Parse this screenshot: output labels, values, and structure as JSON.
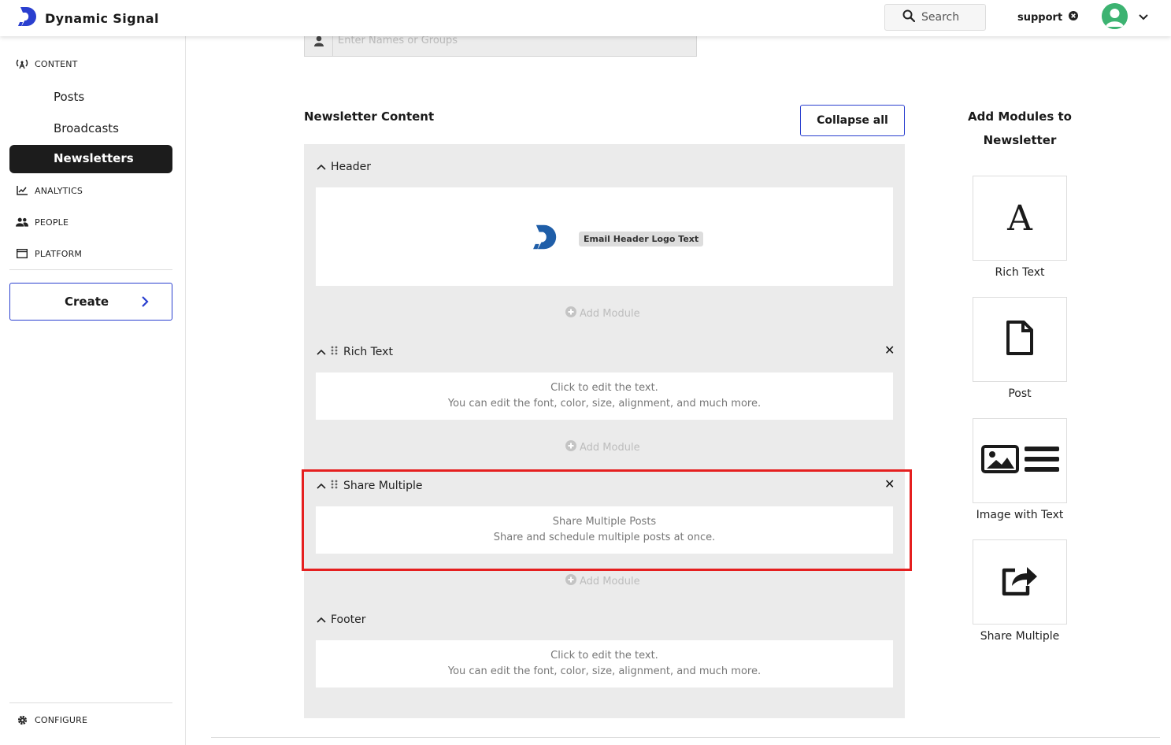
{
  "app": {
    "brand_name": "Dynamic Signal",
    "brand_color": "#2a3fcf",
    "accent_color": "#2a3fcf",
    "highlight_color": "#e51f1f"
  },
  "topbar": {
    "search_label": "Search",
    "user_label": "support"
  },
  "sidebar": {
    "content_label": "CONTENT",
    "content_items": [
      {
        "label": "Posts"
      },
      {
        "label": "Broadcasts"
      },
      {
        "label": "Newsletters",
        "active": true
      }
    ],
    "analytics_label": "ANALYTICS",
    "people_label": "PEOPLE",
    "platform_label": "PLATFORM",
    "create_label": "Create",
    "configure_label": "CONFIGURE"
  },
  "recipients": {
    "placeholder": "Enter Names or Groups"
  },
  "newsletter": {
    "section_title": "Newsletter Content",
    "collapse_all_label": "Collapse all",
    "add_module_label": "Add Module",
    "modules": [
      {
        "title": "Header",
        "logo_text": "Email Header Logo Text"
      },
      {
        "title": "Rich Text",
        "line1": "Click to edit the text.",
        "line2": "You can edit the font, color, size, alignment, and much more."
      },
      {
        "title": "Share Multiple",
        "line1": "Share Multiple Posts",
        "line2": "Share and schedule multiple posts at once."
      },
      {
        "title": "Footer",
        "line1": "Click to edit the text.",
        "line2": "You can edit the font, color, size, alignment, and much more."
      }
    ]
  },
  "add_modules_panel": {
    "title_line1": "Add Modules to",
    "title_line2": "Newsletter",
    "tiles": [
      {
        "label": "Rich Text",
        "glyph": "A",
        "icon": "rich-text-icon"
      },
      {
        "label": "Post",
        "icon": "document-icon"
      },
      {
        "label": "Image with Text",
        "icon": "image-with-text-icon"
      },
      {
        "label": "Share Multiple",
        "icon": "share-icon"
      }
    ]
  }
}
